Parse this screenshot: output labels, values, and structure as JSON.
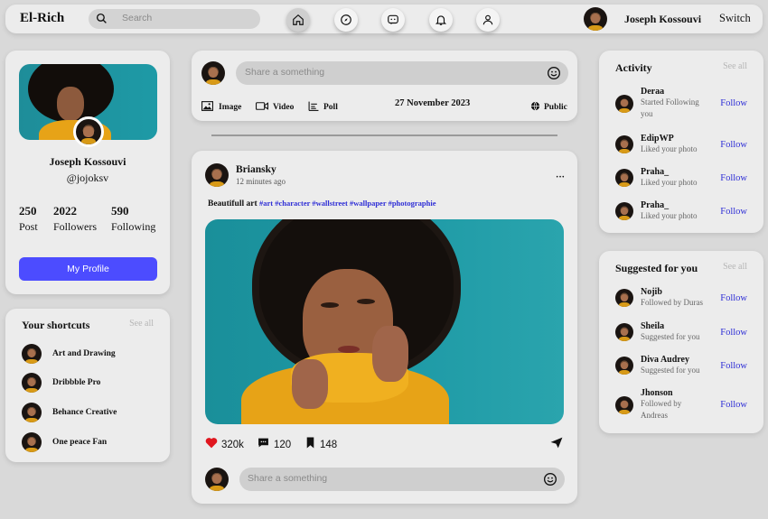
{
  "topbar": {
    "logo": "El-Rich",
    "search_placeholder": "Search",
    "user_name": "Joseph Kossouvi",
    "switch_label": "Switch"
  },
  "profile": {
    "name": "Joseph Kossouvi",
    "handle": "@jojoksv",
    "stats": [
      {
        "value": "250",
        "label": "Post"
      },
      {
        "value": "2022",
        "label": "Followers"
      },
      {
        "value": "590",
        "label": "Following"
      }
    ],
    "button_label": "My Profile"
  },
  "shortcuts": {
    "title": "Your shortcuts",
    "see_all": "See all",
    "items": [
      {
        "label": "Art and Drawing"
      },
      {
        "label": "Dribbble Pro"
      },
      {
        "label": "Behance Creative"
      },
      {
        "label": "One peace Fan"
      }
    ]
  },
  "composer": {
    "placeholder": "Share a something",
    "actions": [
      {
        "label": "Image",
        "icon": "image-icon"
      },
      {
        "label": "Video",
        "icon": "video-icon"
      },
      {
        "label": "Poll",
        "icon": "poll-icon"
      }
    ],
    "date": "27 November 2023",
    "visibility": "Public"
  },
  "post": {
    "author": "Briansky",
    "time": "12 minutes ago",
    "more": "···",
    "caption_text": "Beautifull art",
    "hashtags": "#art #character #wallstreet #wallpaper #photographie",
    "likes": "320k",
    "comments": "120",
    "saves": "148",
    "comment_placeholder": "Share a something"
  },
  "activity": {
    "title": "Activity",
    "see_all": "See all",
    "items": [
      {
        "name": "Deraa",
        "desc": "Started Following you",
        "action": "Follow"
      },
      {
        "name": "EdipWP",
        "desc": "Liked your photo",
        "action": "Follow"
      },
      {
        "name": "Praha_",
        "desc": "Liked your photo",
        "action": "Follow"
      },
      {
        "name": "Praha_",
        "desc": "Liked your photo",
        "action": "Follow"
      }
    ]
  },
  "suggested": {
    "title": "Suggested for you",
    "see_all": "See all",
    "items": [
      {
        "name": "Nojib",
        "desc": "Followed by Duras",
        "action": "Follow"
      },
      {
        "name": "Sheila",
        "desc": "Suggested for you",
        "action": "Follow"
      },
      {
        "name": "Diva Audrey",
        "desc": "Suggested for you",
        "action": "Follow"
      },
      {
        "name": "Jhonson",
        "desc": "Followed by Andreas",
        "action": "Follow"
      }
    ]
  },
  "colors": {
    "accent": "#4c4cff",
    "link": "#2f2fd6",
    "like": "#e0161e",
    "photo_bg": "#1e9aa6",
    "sweater": "#e7a317"
  }
}
